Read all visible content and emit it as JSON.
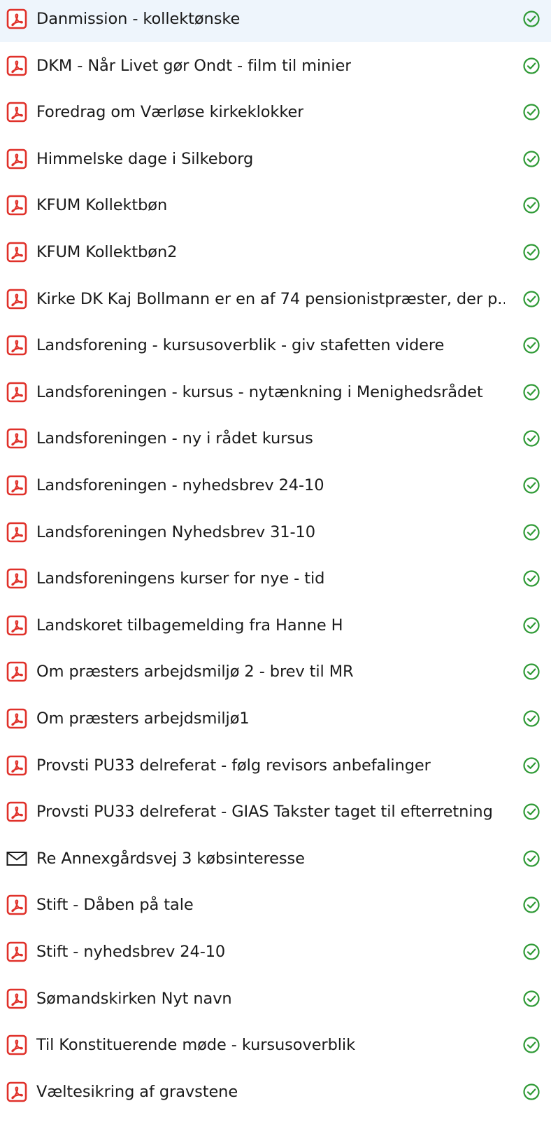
{
  "colors": {
    "pdf_icon": "#e0312a",
    "sync_ok": "#2f9a36",
    "text": "#1a1a1a"
  },
  "files": [
    {
      "name": "Danmission - kollektønske",
      "icon": "pdf-icon",
      "status": "available-offline-icon"
    },
    {
      "name": "DKM - Når Livet gør Ondt - film til minier",
      "icon": "pdf-icon",
      "status": "available-offline-icon"
    },
    {
      "name": "Foredrag om Værløse kirkeklokker",
      "icon": "pdf-icon",
      "status": "available-offline-icon"
    },
    {
      "name": "Himmelske dage i Silkeborg",
      "icon": "pdf-icon",
      "status": "available-offline-icon"
    },
    {
      "name": "KFUM Kollektbøn",
      "icon": "pdf-icon",
      "status": "available-offline-icon"
    },
    {
      "name": "KFUM Kollektbøn2",
      "icon": "pdf-icon",
      "status": "available-offline-icon"
    },
    {
      "name": "Kirke DK Kaj Bollmann er en af 74 pensionistpræster, der p...",
      "icon": "pdf-icon",
      "status": "available-offline-icon"
    },
    {
      "name": "Landsforening - kursusoverblik - giv stafetten videre",
      "icon": "pdf-icon",
      "status": "available-offline-icon"
    },
    {
      "name": "Landsforeningen - kursus - nytænkning i Menighedsrådet",
      "icon": "pdf-icon",
      "status": "available-offline-icon"
    },
    {
      "name": "Landsforeningen - ny i rådet kursus",
      "icon": "pdf-icon",
      "status": "available-offline-icon"
    },
    {
      "name": "Landsforeningen - nyhedsbrev 24-10",
      "icon": "pdf-icon",
      "status": "available-offline-icon"
    },
    {
      "name": "Landsforeningen Nyhedsbrev 31-10",
      "icon": "pdf-icon",
      "status": "available-offline-icon"
    },
    {
      "name": "Landsforeningens kurser for nye - tid",
      "icon": "pdf-icon",
      "status": "available-offline-icon"
    },
    {
      "name": "Landskoret tilbagemelding fra Hanne H",
      "icon": "pdf-icon",
      "status": "available-offline-icon"
    },
    {
      "name": "Om præsters arbejdsmiljø 2 - brev til MR",
      "icon": "pdf-icon",
      "status": "available-offline-icon"
    },
    {
      "name": "Om præsters arbejdsmiljø1",
      "icon": "pdf-icon",
      "status": "available-offline-icon"
    },
    {
      "name": "Provsti PU33 delreferat - følg revisors anbefalinger",
      "icon": "pdf-icon",
      "status": "available-offline-icon"
    },
    {
      "name": "Provsti PU33 delreferat - GIAS Takster taget til efterretning",
      "icon": "pdf-icon",
      "status": "available-offline-icon"
    },
    {
      "name": "Re Annexgårdsvej 3 købsinteresse",
      "icon": "mail-icon",
      "status": "available-offline-icon"
    },
    {
      "name": "Stift - Dåben på tale",
      "icon": "pdf-icon",
      "status": "available-offline-icon"
    },
    {
      "name": "Stift - nyhedsbrev 24-10",
      "icon": "pdf-icon",
      "status": "available-offline-icon"
    },
    {
      "name": "Sømandskirken Nyt navn",
      "icon": "pdf-icon",
      "status": "available-offline-icon"
    },
    {
      "name": "Til Konstituerende møde - kursusoverblik",
      "icon": "pdf-icon",
      "status": "available-offline-icon"
    },
    {
      "name": "Væltesikring af gravstene",
      "icon": "pdf-icon",
      "status": "available-offline-icon"
    }
  ]
}
